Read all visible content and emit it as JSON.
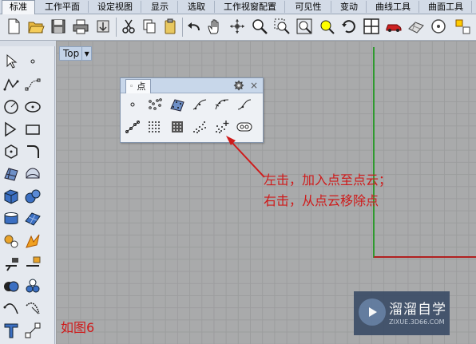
{
  "tabs": [
    "标准",
    "工作平面",
    "设定视图",
    "显示",
    "选取",
    "工作视窗配置",
    "可见性",
    "变动",
    "曲线工具",
    "曲面工具"
  ],
  "toolbar_icons": [
    "new-file-icon",
    "open-folder-icon",
    "save-icon",
    "print-icon",
    "import-icon",
    "cut-icon",
    "copy-icon",
    "paste-icon",
    "undo-icon",
    "pan-hand-icon",
    "rotate-view-icon",
    "zoom-icon",
    "zoom-window-icon",
    "zoom-extents-icon",
    "zoom-selected-icon",
    "rotate-camera-icon",
    "four-viewports-icon",
    "car-render-icon",
    "grid-surface-icon",
    "circle-target-icon",
    "light-icon"
  ],
  "left_toolbar_icons": [
    "select-arrow-icon",
    "point-icon",
    "polyline-icon",
    "control-point-curve-icon",
    "circle-icon",
    "arc-icon",
    "ellipse-icon",
    "rectangle-icon",
    "polygon-icon",
    "fillet-curve-icon",
    "surface-patch-icon",
    "loft-surface-icon",
    "box-solid-icon",
    "sphere-solid-icon",
    "cylinder-icon",
    "mesh-plane-icon",
    "gear-puzzle-icon",
    "explode-icon",
    "trim-icon",
    "split-icon",
    "boolean-union-icon",
    "group-icon",
    "curve-offset-icon",
    "rebuild-icon",
    "text-object-icon",
    "transform-scale-icon"
  ],
  "viewport": {
    "label": "Top",
    "dropdown_glyph": "▼"
  },
  "panel": {
    "tab_label": "点",
    "tab_glyph": "◦",
    "close_glyph": "×",
    "icons": [
      "single-point-icon",
      "multiple-points-icon",
      "point-grid-icon",
      "divide-curve-icon",
      "points-on-curve-icon",
      "closest-point-icon",
      "points-along-line-icon",
      "point-array-icon",
      "dense-point-grid-icon",
      "point-cloud-icon",
      "point-cloud-add-icon",
      "extract-points-icon"
    ]
  },
  "annotation": {
    "line1": "左击，加入点至点云；",
    "line2": "右击，从点云移除点"
  },
  "figure_label": "如图6",
  "watermark": {
    "title": "溜溜自学",
    "subtitle": "ZIXUE.3D66.COM"
  },
  "colors": {
    "annotation": "#cf1a1a",
    "axis_x": "#b12020",
    "axis_y": "#2f9a2f",
    "viewport_bg": "#a9aaab"
  }
}
